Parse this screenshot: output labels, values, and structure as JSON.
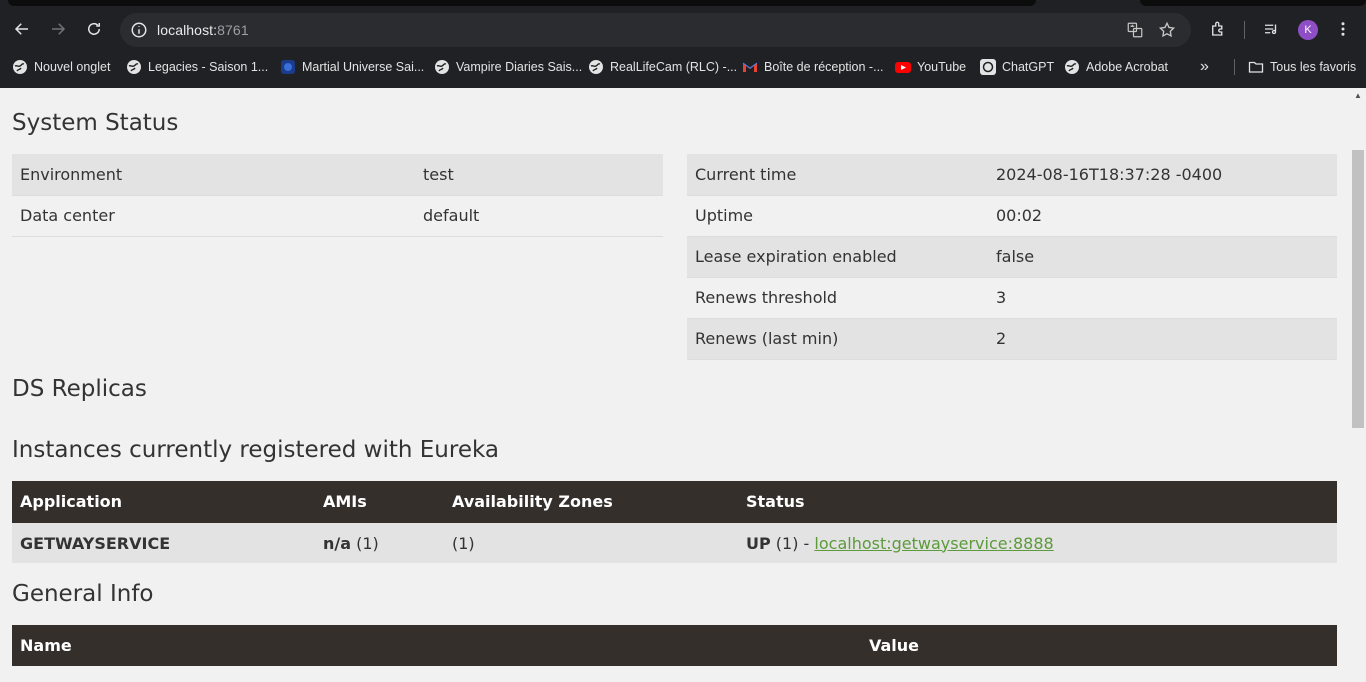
{
  "browser": {
    "url_host": "localhost:",
    "url_port": "8761",
    "profile_initial": "K",
    "bookmarks": [
      {
        "label": "Nouvel onglet",
        "icon": "globe-icon"
      },
      {
        "label": "Legacies - Saison 1...",
        "icon": "globe-icon"
      },
      {
        "label": "Martial Universe Sai...",
        "icon": "site-favicon"
      },
      {
        "label": "Vampire Diaries Sais...",
        "icon": "globe-icon"
      },
      {
        "label": "RealLifeCam (RLC) -...",
        "icon": "globe-icon"
      },
      {
        "label": "Boîte de réception -...",
        "icon": "gmail-icon"
      },
      {
        "label": "YouTube",
        "icon": "youtube-icon"
      },
      {
        "label": "ChatGPT",
        "icon": "chatgpt-icon"
      },
      {
        "label": "Adobe Acrobat",
        "icon": "globe-icon"
      }
    ],
    "all_bookmarks_label": "Tous les favoris",
    "more_label": "»"
  },
  "system_status": {
    "title": "System Status",
    "left": [
      {
        "key": "Environment",
        "value": "test"
      },
      {
        "key": "Data center",
        "value": "default"
      }
    ],
    "right": [
      {
        "key": "Current time",
        "value": "2024-08-16T18:37:28 -0400"
      },
      {
        "key": "Uptime",
        "value": "00:02"
      },
      {
        "key": "Lease expiration enabled",
        "value": "false"
      },
      {
        "key": "Renews threshold",
        "value": "3"
      },
      {
        "key": "Renews (last min)",
        "value": "2"
      }
    ]
  },
  "ds_replicas": {
    "title": "DS Replicas"
  },
  "instances": {
    "title": "Instances currently registered with Eureka",
    "headers": [
      "Application",
      "AMIs",
      "Availability Zones",
      "Status"
    ],
    "rows": [
      {
        "application": "GETWAYSERVICE",
        "amis_bold": "n/a",
        "amis_count": " (1)",
        "zones": "(1)",
        "status_bold": "UP",
        "status_count": " (1) - ",
        "status_link": "localhost:getwayservice:8888"
      }
    ]
  },
  "general_info": {
    "title": "General Info",
    "headers": [
      "Name",
      "Value"
    ]
  },
  "colors": {
    "header_dark": "#342f2b",
    "link_green": "#5c9a3b",
    "row_stripe": "#e3e3e3",
    "page_bg": "#f1f1f1"
  }
}
